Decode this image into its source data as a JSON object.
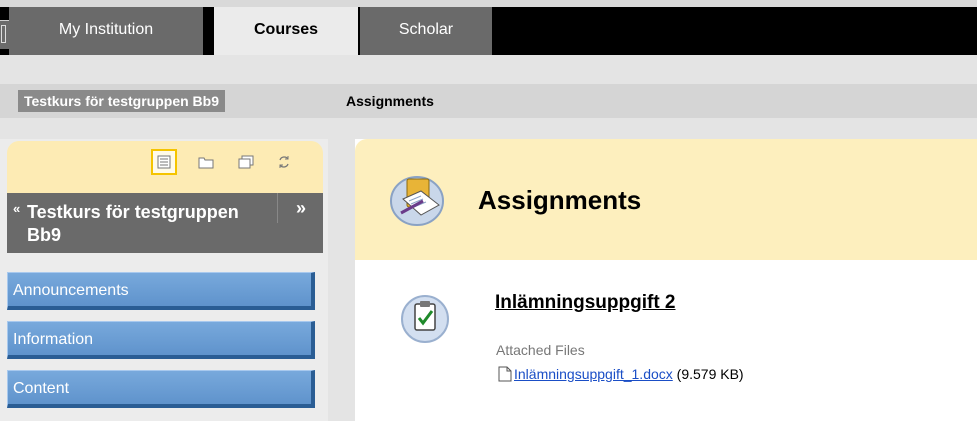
{
  "top_tabs": [
    {
      "label": "My Institution",
      "active": false
    },
    {
      "label": "Courses",
      "active": true
    },
    {
      "label": "Scholar",
      "active": false
    }
  ],
  "breadcrumb": {
    "course": "Testkurs för testgruppen Bb9",
    "current": "Assignments"
  },
  "course_menu": {
    "tools": [
      "folder-view-icon",
      "folder-icon",
      "new-window-icon",
      "refresh-icon"
    ],
    "collapse_glyph": "«",
    "title": "Testkurs för testgruppen Bb9",
    "expand_glyph": "»",
    "items": [
      "Announcements",
      "Information",
      "Content"
    ]
  },
  "page": {
    "title": "Assignments",
    "item": {
      "title": "Inlämningsuppgift 2",
      "attached_label": "Attached Files",
      "file_name": "Inlämningsuppgift_1.docx",
      "file_size": "(9.579 KB)"
    }
  },
  "colors": {
    "menu_button": "#6b9fd4",
    "header_bg": "#fdefbe",
    "tab_bg": "#6a6a6a",
    "link": "#1a4ec6"
  }
}
